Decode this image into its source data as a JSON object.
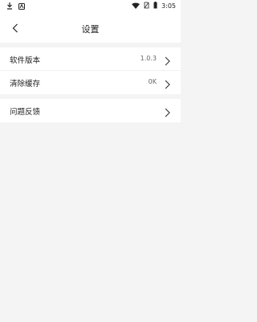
{
  "status_bar": {
    "time": "3:05",
    "icons": [
      "download-icon",
      "app-notification-icon",
      "wifi-icon",
      "no-sim-icon",
      "battery-icon"
    ]
  },
  "header": {
    "title": "设置",
    "back_icon": "chevron-left-icon"
  },
  "settings": {
    "items": [
      {
        "label": "软件版本",
        "value": "1.0.3"
      },
      {
        "label": "清除缓存",
        "value": "0K"
      },
      {
        "label": "问题反馈",
        "value": ""
      }
    ]
  },
  "colors": {
    "background": "#f4f4f4",
    "surface": "#ffffff",
    "text": "#222222",
    "secondary_text": "#666666"
  }
}
